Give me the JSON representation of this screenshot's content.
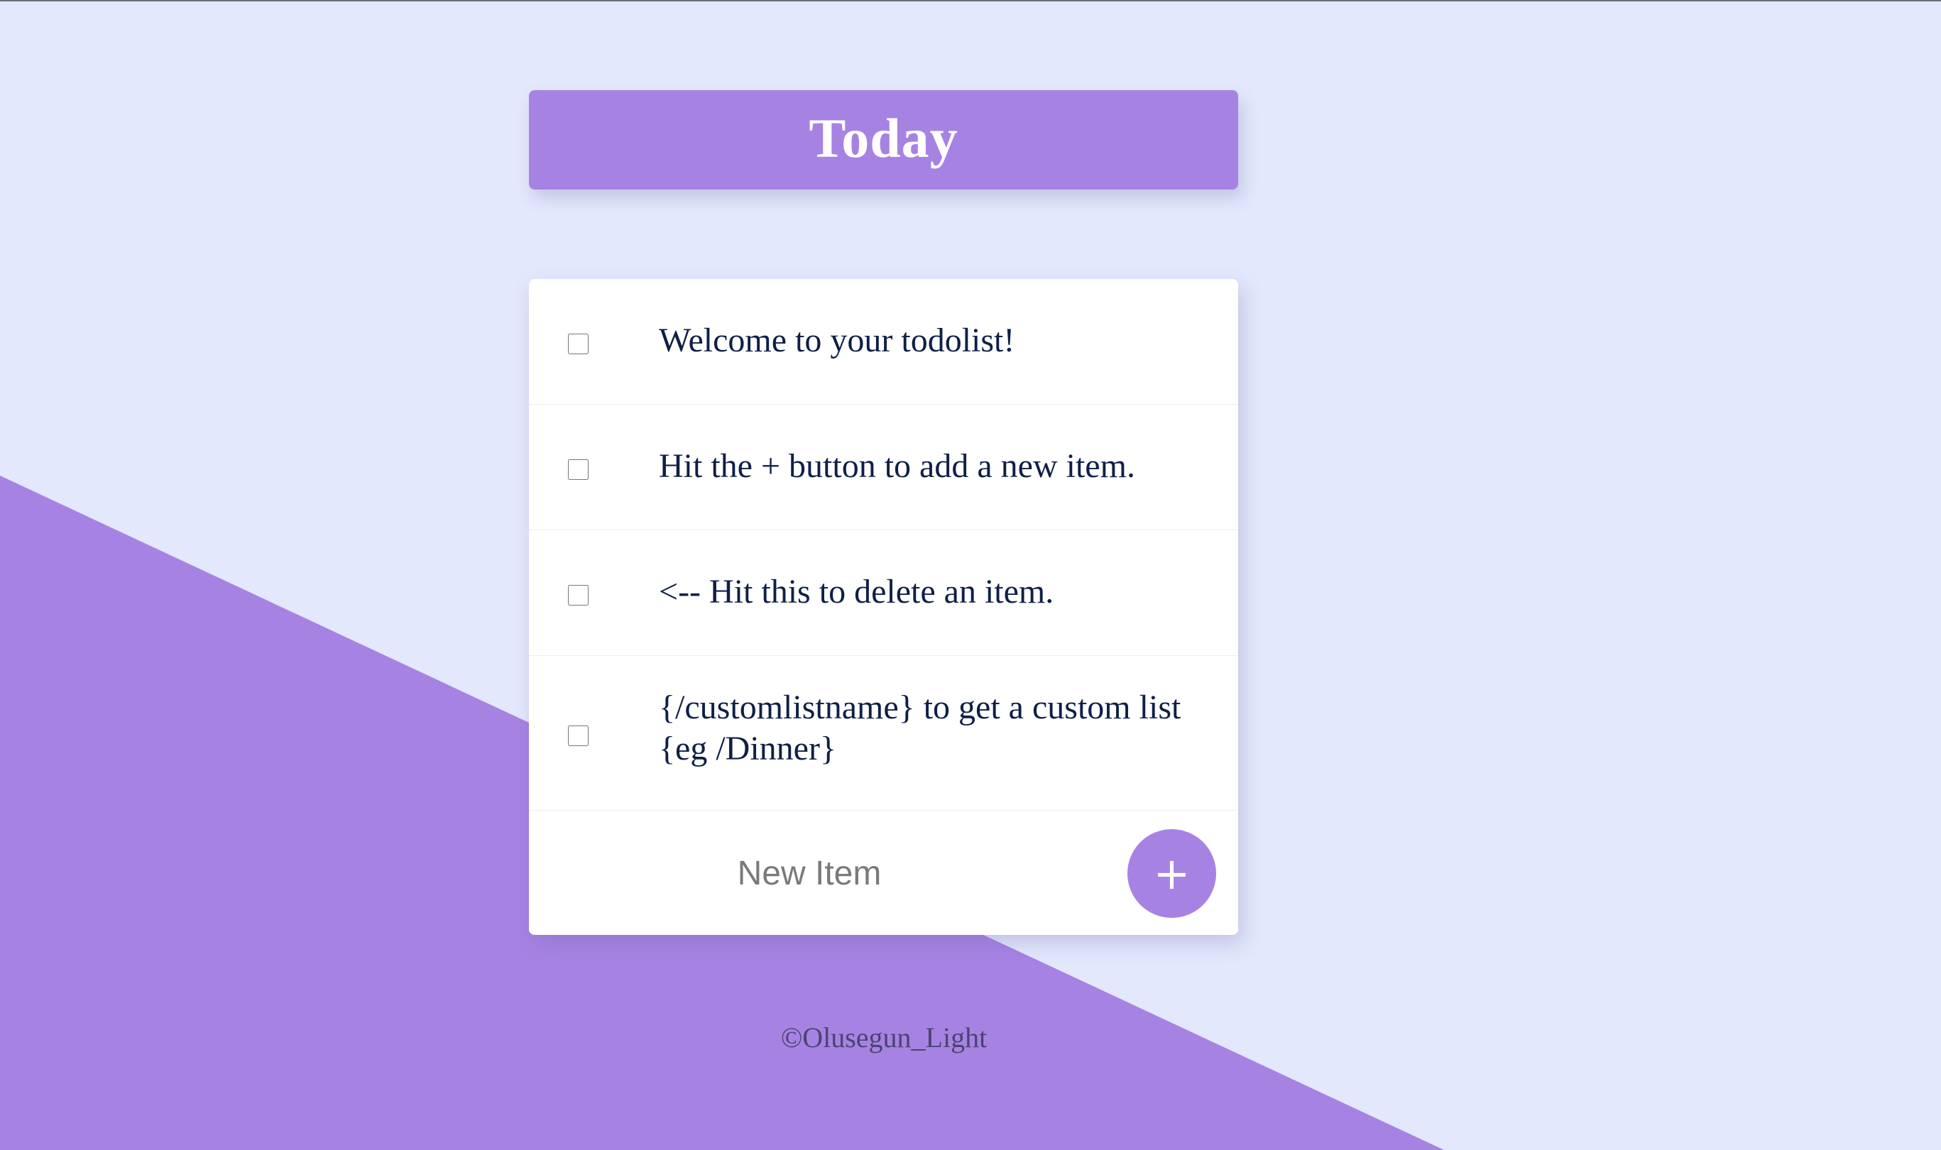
{
  "header": {
    "title": "Today"
  },
  "items": [
    {
      "text": "Welcome to your todolist!",
      "checked": false
    },
    {
      "text": "Hit the + button to add a new item.",
      "checked": false
    },
    {
      "text": "<-- Hit this to delete an item.",
      "checked": false
    },
    {
      "text": "{/customlistname} to get a custom list {eg /Dinner}",
      "checked": false
    }
  ],
  "new_item": {
    "placeholder": "New Item",
    "value": "",
    "add_button_label": "+"
  },
  "footer": {
    "text": "©Olusegun_Light"
  },
  "colors": {
    "accent": "#a683e3",
    "background": "#e3e8fc",
    "card": "#ffffff",
    "item_text": "#0f1f47"
  }
}
